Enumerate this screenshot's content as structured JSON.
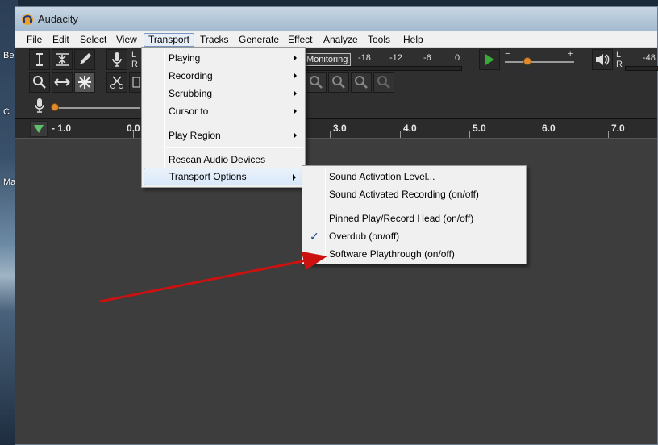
{
  "app": {
    "title": "Audacity"
  },
  "desktop": {
    "labels": [
      "Be",
      "C",
      "Ma"
    ]
  },
  "menubar": {
    "items": [
      "File",
      "Edit",
      "Select",
      "View",
      "Transport",
      "Tracks",
      "Generate",
      "Effect",
      "Analyze",
      "Tools",
      "Help"
    ],
    "active": "Transport"
  },
  "meters": {
    "record_lr": [
      "L",
      "R"
    ],
    "playback_lr": [
      "L",
      "R"
    ],
    "monitoring_label": "Monitoring",
    "record_scale": [
      "-18",
      "-12",
      "-6",
      "0"
    ],
    "playback_scale_partial": "-48",
    "speed_minus": "−",
    "speed_plus": "+",
    "mic_minus": "−"
  },
  "ruler": {
    "ticks": [
      "- 1.0",
      "0.0",
      "3.0",
      "4.0",
      "5.0",
      "6.0",
      "7.0"
    ]
  },
  "transport_menu": {
    "items": [
      {
        "label": "Playing",
        "submenu": true
      },
      {
        "label": "Recording",
        "submenu": true
      },
      {
        "label": "Scrubbing",
        "submenu": true
      },
      {
        "label": "Cursor to",
        "submenu": true
      },
      {
        "label": "Play Region",
        "submenu": true
      },
      {
        "label": "Rescan Audio Devices",
        "submenu": false
      },
      {
        "label": "Transport Options",
        "submenu": true,
        "highlighted": true
      }
    ]
  },
  "transport_options_menu": {
    "items": [
      {
        "label": "Sound Activation Level...",
        "checked": false
      },
      {
        "label": "Sound Activated Recording (on/off)",
        "checked": false
      },
      {
        "label": "Pinned Play/Record Head (on/off)",
        "checked": false
      },
      {
        "label": "Overdub (on/off)",
        "checked": true
      },
      {
        "label": "Software Playthrough (on/off)",
        "checked": false
      }
    ],
    "check_glyph": "✓"
  },
  "colors": {
    "annotation_arrow": "#cc1111",
    "slider_knob": "#e08a2c",
    "play_green": "#3aa83a"
  }
}
